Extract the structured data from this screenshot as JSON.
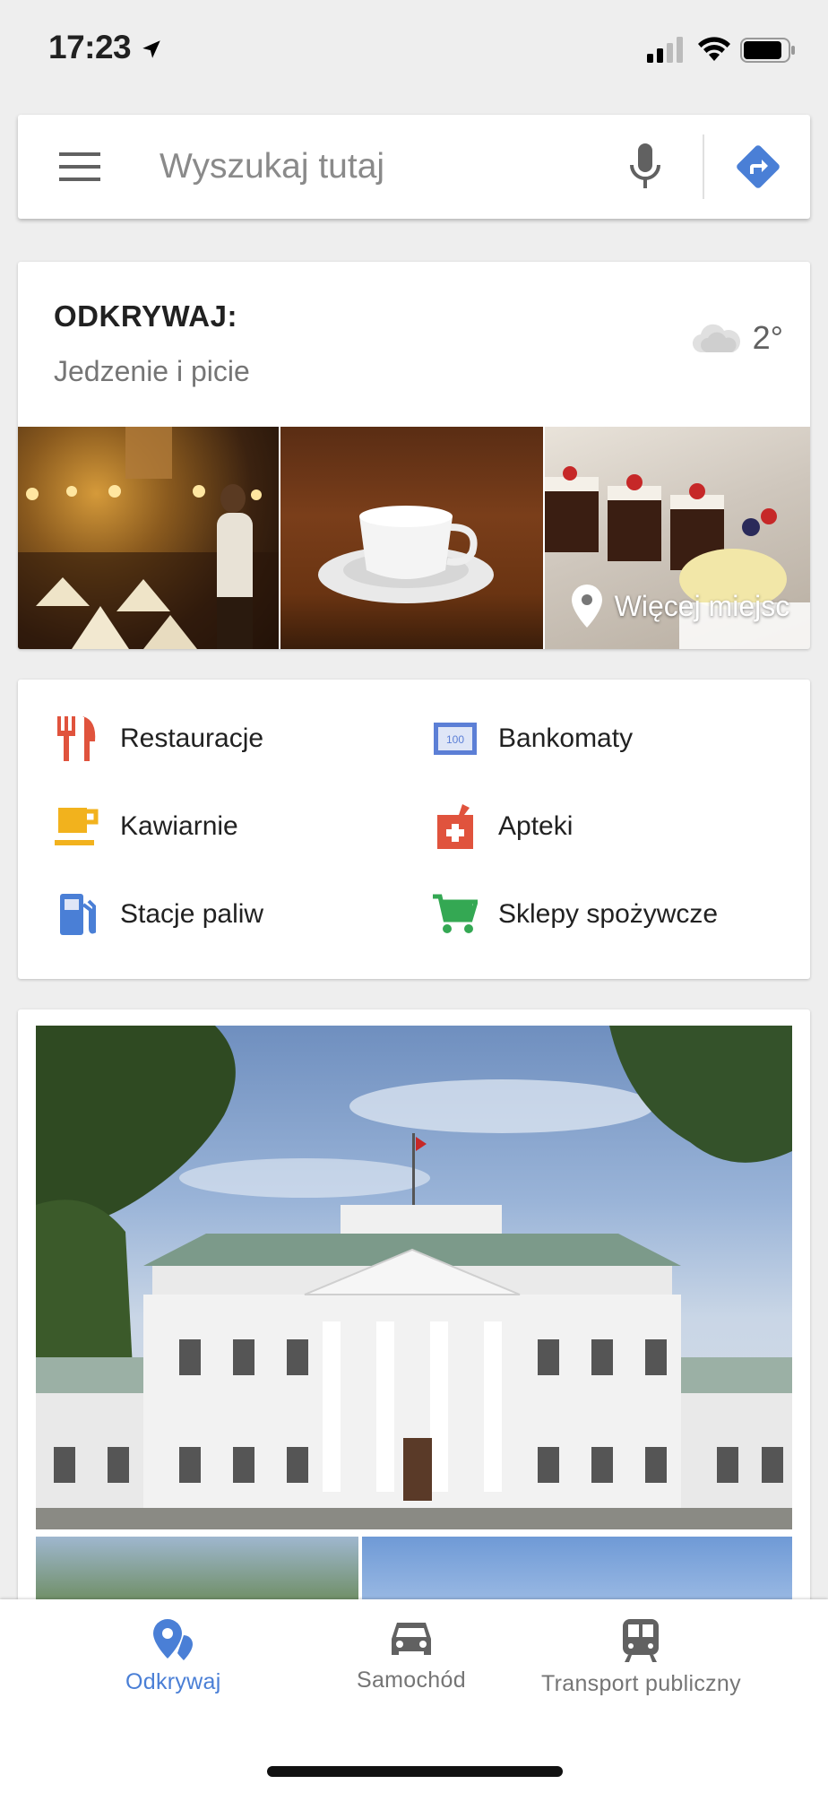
{
  "status_bar": {
    "time": "17:23",
    "icons": [
      "location-arrow-icon",
      "signal-icon",
      "wifi-icon",
      "battery-icon"
    ]
  },
  "search": {
    "placeholder": "Wyszukaj tutaj",
    "icons": [
      "menu-icon",
      "microphone-icon",
      "directions-icon"
    ]
  },
  "explore": {
    "title": "ODKRYWAJ:",
    "subtitle": "Jedzenie i picie",
    "weather": {
      "icon": "cloud-icon",
      "temperature": "2°"
    },
    "more_places_label": "Więcej miejsc"
  },
  "categories": [
    {
      "label": "Restauracje",
      "icon": "fork-knife-icon",
      "color": "#e0533d"
    },
    {
      "label": "Bankomaty",
      "icon": "atm-icon",
      "color": "#5c7fd6"
    },
    {
      "label": "Kawiarnie",
      "icon": "coffee-cup-icon",
      "color": "#f2b21d"
    },
    {
      "label": "Apteki",
      "icon": "pharmacy-icon",
      "color": "#e0533d"
    },
    {
      "label": "Stacje paliw",
      "icon": "gas-station-icon",
      "color": "#4a7fd6"
    },
    {
      "label": "Sklepy spożywcze",
      "icon": "shopping-cart-icon",
      "color": "#34a853"
    }
  ],
  "bottom_nav": [
    {
      "label": "Odkrywaj",
      "icon": "explore-pin-icon",
      "active": true
    },
    {
      "label": "Samochód",
      "icon": "car-icon",
      "active": false
    },
    {
      "label": "Transport publiczny",
      "icon": "train-icon",
      "active": false
    }
  ],
  "colors": {
    "accent": "#4a7fd6",
    "background": "#eeeeee",
    "card": "#ffffff"
  }
}
